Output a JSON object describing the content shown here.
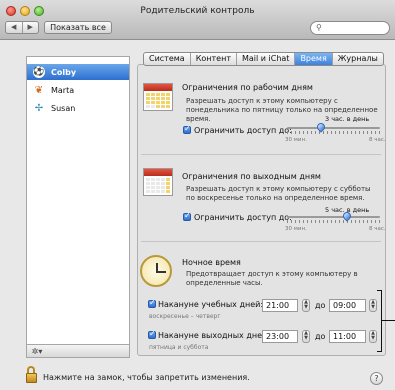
{
  "window": {
    "title": "Родительский контроль"
  },
  "toolbar": {
    "back": "◀",
    "forward": "▶",
    "show_all": "Показать все",
    "search_placeholder": ""
  },
  "users": [
    {
      "name": "Colby",
      "selected": true,
      "icon": "soccer-ball-icon"
    },
    {
      "name": "Marta",
      "selected": false,
      "icon": "butterfly-icon"
    },
    {
      "name": "Susan",
      "selected": false,
      "icon": "dragonfly-icon"
    }
  ],
  "tabs": [
    {
      "label": "Система",
      "active": false
    },
    {
      "label": "Контент",
      "active": false
    },
    {
      "label": "Mail и iChat",
      "active": false
    },
    {
      "label": "Время",
      "active": true
    },
    {
      "label": "Журналы",
      "active": false
    }
  ],
  "weekday": {
    "title": "Ограничения по рабочим дням",
    "desc": "Разрешать доступ к этому компьютеру с понедельника по пятницу только на определенное время.",
    "checkbox_label": "Ограничить доступ до:",
    "checked": true,
    "value": "3 час. в день",
    "min": "30 мин.",
    "max": "8 час.",
    "level": 0.37
  },
  "weekend": {
    "title": "Ограничения по выходным дням",
    "desc": "Разрешать доступ к этому компьютеру с субботы по воскресенье только на определенное время.",
    "checkbox_label": "Ограничить доступ до:",
    "checked": true,
    "value": "5 час. в день",
    "min": "30 мин.",
    "max": "8 час.",
    "level": 0.64
  },
  "bedtime": {
    "title": "Ночное время",
    "desc": "Предотвращает доступ к этому компьютеру в определенные часы.",
    "school": {
      "label": "Накануне учебных дней:",
      "sub": "воскресенье – четверг",
      "from": "21:00",
      "to_label": "до",
      "to": "09:00",
      "checked": true
    },
    "weekend": {
      "label": "Накануне выходных дней:",
      "sub": "пятница и суббота",
      "from": "23:00",
      "to_label": "до",
      "to": "11:00",
      "checked": true
    }
  },
  "footer": {
    "lock_text": "Нажмите на замок, чтобы запретить изменения.",
    "help": "?"
  },
  "colors": {
    "accent": "#3c82de",
    "selection": "#2d6fd0"
  }
}
